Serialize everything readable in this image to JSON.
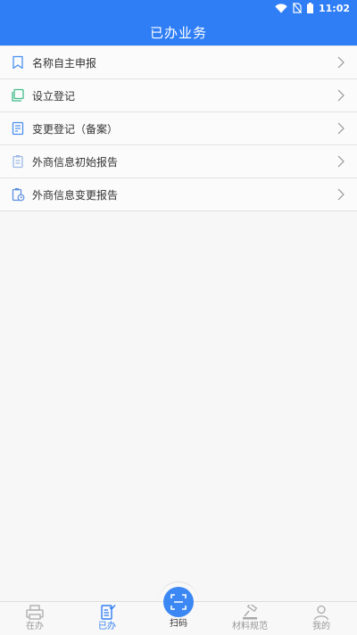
{
  "status_bar": {
    "time": "11:02",
    "icons": [
      "wifi-icon",
      "no-sim-icon",
      "battery-icon"
    ]
  },
  "header": {
    "title": "已办业务"
  },
  "list": {
    "items": [
      {
        "label": "名称自主申报",
        "icon": "bookmark-icon"
      },
      {
        "label": "设立登记",
        "icon": "copy-icon"
      },
      {
        "label": "变更登记（备案）",
        "icon": "document-edit-icon"
      },
      {
        "label": "外商信息初始报告",
        "icon": "report-doc-icon"
      },
      {
        "label": "外商信息变更报告",
        "icon": "report-clock-icon"
      }
    ]
  },
  "tabbar": {
    "tabs": [
      {
        "label": "在办",
        "icon": "printer-icon",
        "active": false
      },
      {
        "label": "已办",
        "icon": "checklist-icon",
        "active": true
      },
      {
        "label": "扫码",
        "icon": "scan-icon",
        "active": false
      },
      {
        "label": "材料规范",
        "icon": "gavel-icon",
        "active": false
      },
      {
        "label": "我的",
        "icon": "user-icon",
        "active": false
      }
    ]
  },
  "colors": {
    "primary": "#2f7ef6",
    "scan_button": "#3b87f3",
    "background": "#f7f7f7"
  }
}
